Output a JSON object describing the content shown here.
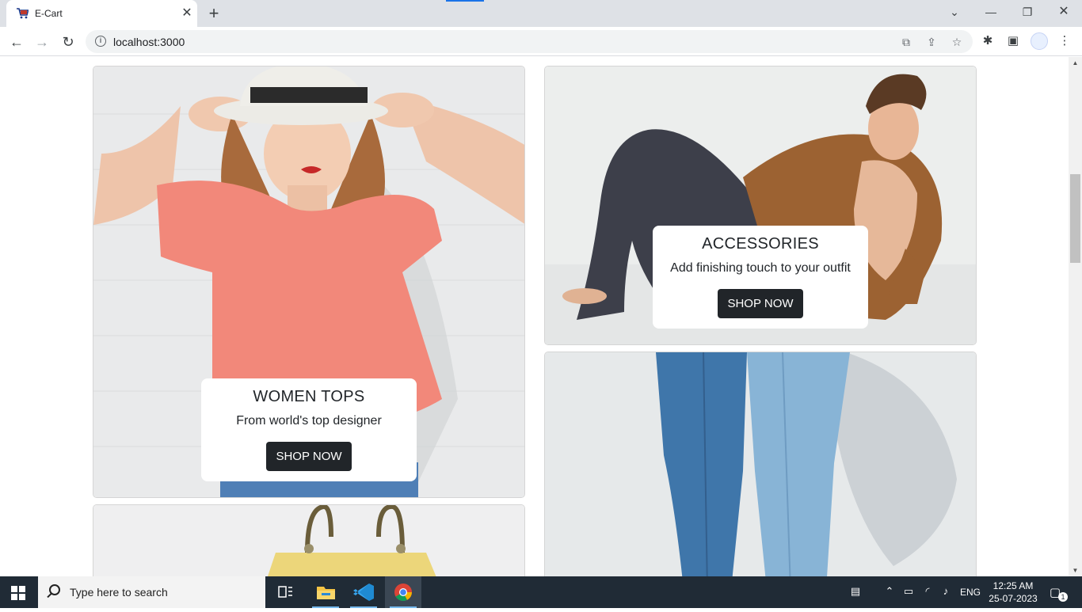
{
  "browser": {
    "tab_title": "E-Cart",
    "url": "localhost:3000"
  },
  "cards": {
    "women": {
      "title": "WOMEN TOPS",
      "subtitle": "From world's top designer",
      "button": "SHOP NOW"
    },
    "accessories": {
      "title": "ACCESSORIES",
      "subtitle": "Add finishing touch to your outfit",
      "button": "SHOP NOW"
    }
  },
  "taskbar": {
    "search_placeholder": "Type here to search",
    "language": "ENG",
    "time": "12:25 AM",
    "date": "25-07-2023",
    "notification_count": "1"
  },
  "colors": {
    "button_bg": "#212529",
    "taskbar_bg": "#202b36",
    "tabbar_bg": "#dee1e6"
  }
}
